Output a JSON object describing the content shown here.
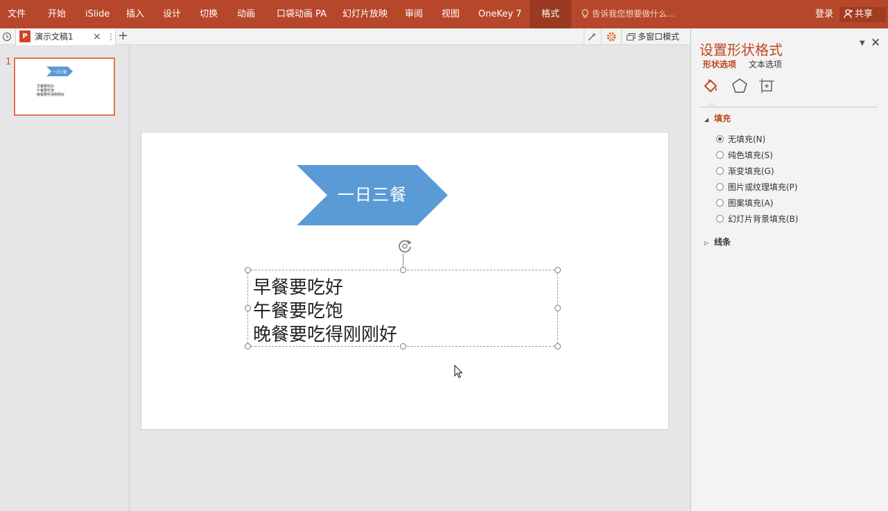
{
  "ribbon": {
    "tabs": [
      "文件",
      "开始",
      "iSlide",
      "插入",
      "设计",
      "切换",
      "动画",
      "口袋动画 PA",
      "幻灯片放映",
      "审阅",
      "视图",
      "OneKey 7",
      "格式"
    ],
    "active_tab": "格式",
    "tell_me": "告诉我您想要做什么...",
    "login": "登录",
    "share": "共享",
    "color": "#b7472a"
  },
  "tabbar": {
    "doc_name": "演示文稿1",
    "close": "×",
    "more": "⋮",
    "new_tab": "+",
    "multi_window": "多窗口模式"
  },
  "thumbnails": {
    "slide_number": "1",
    "chevron_text": "一日三餐",
    "lines": [
      "早餐要吃好",
      "午餐要吃饱",
      "晚餐要吃得刚刚好"
    ]
  },
  "slide": {
    "chevron_text": "一日三餐",
    "chevron_color": "#5b9bd5",
    "text_lines": [
      "早餐要吃好",
      "午餐要吃饱",
      "晚餐要吃得刚刚好"
    ]
  },
  "format_pane": {
    "title": "设置形状格式",
    "tab_shape": "形状选项",
    "tab_text": "文本选项",
    "fill_section": "填充",
    "fill_options": [
      "无填充(N)",
      "纯色填充(S)",
      "渐变填充(G)",
      "图片或纹理填充(P)",
      "图案填充(A)",
      "幻灯片背景填充(B)"
    ],
    "selected_fill": "无填充(N)",
    "line_section": "线条",
    "accent": "#c0461f"
  }
}
